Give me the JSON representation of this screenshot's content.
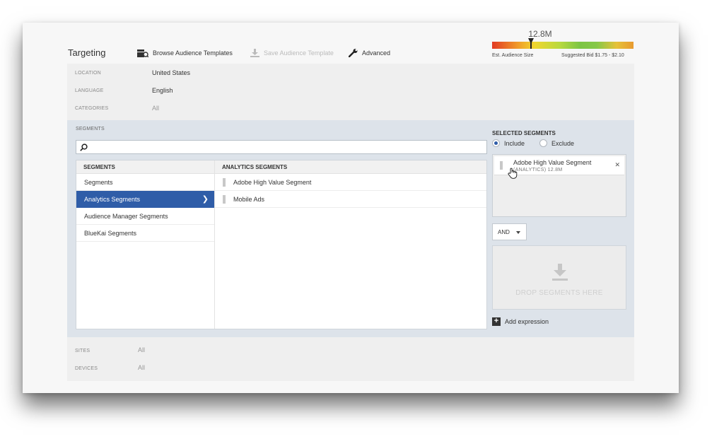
{
  "header": {
    "title": "Targeting",
    "browse_label": "Browse Audience Templates",
    "save_label": "Save Audience Template",
    "advanced_label": "Advanced"
  },
  "bid": {
    "audience_value": "12.8M",
    "audience_label": "Est. Audience Size",
    "suggested_label": "Suggested Bid $1.75 - $2.10"
  },
  "info": {
    "location_label": "LOCATION",
    "location_value": "United States",
    "language_label": "LANGUAGE",
    "language_value": "English",
    "categories_label": "CATEGORIES",
    "categories_value": "All"
  },
  "segments": {
    "label": "SEGMENTS",
    "search_value": "",
    "col1_header": "SEGMENTS",
    "col1_items": [
      {
        "label": "Segments"
      },
      {
        "label": "Analytics Segments",
        "active": true
      },
      {
        "label": "Audience Manager Segments"
      },
      {
        "label": "BlueKai Segments"
      }
    ],
    "col2_header": "ANALYTICS SEGMENTS",
    "col2_items": [
      {
        "label": "Adobe High Value Segment"
      },
      {
        "label": "Mobile Ads"
      }
    ]
  },
  "selected": {
    "title": "SELECTED SEGMENTS",
    "include_label": "Include",
    "exclude_label": "Exclude",
    "mode": "include",
    "chip_name": "Adobe High Value Segment",
    "chip_sub": "(ANALYTICS) 12.8M",
    "operator": "AND",
    "drop_text": "DROP SEGMENTS HERE",
    "add_expression": "Add expression"
  },
  "bottom": {
    "sites_label": "SITES",
    "sites_value": "All",
    "devices_label": "DEVICES",
    "devices_value": "All"
  },
  "colors": {
    "accent": "#2f5da8",
    "segment_bg": "#dde3ea"
  }
}
